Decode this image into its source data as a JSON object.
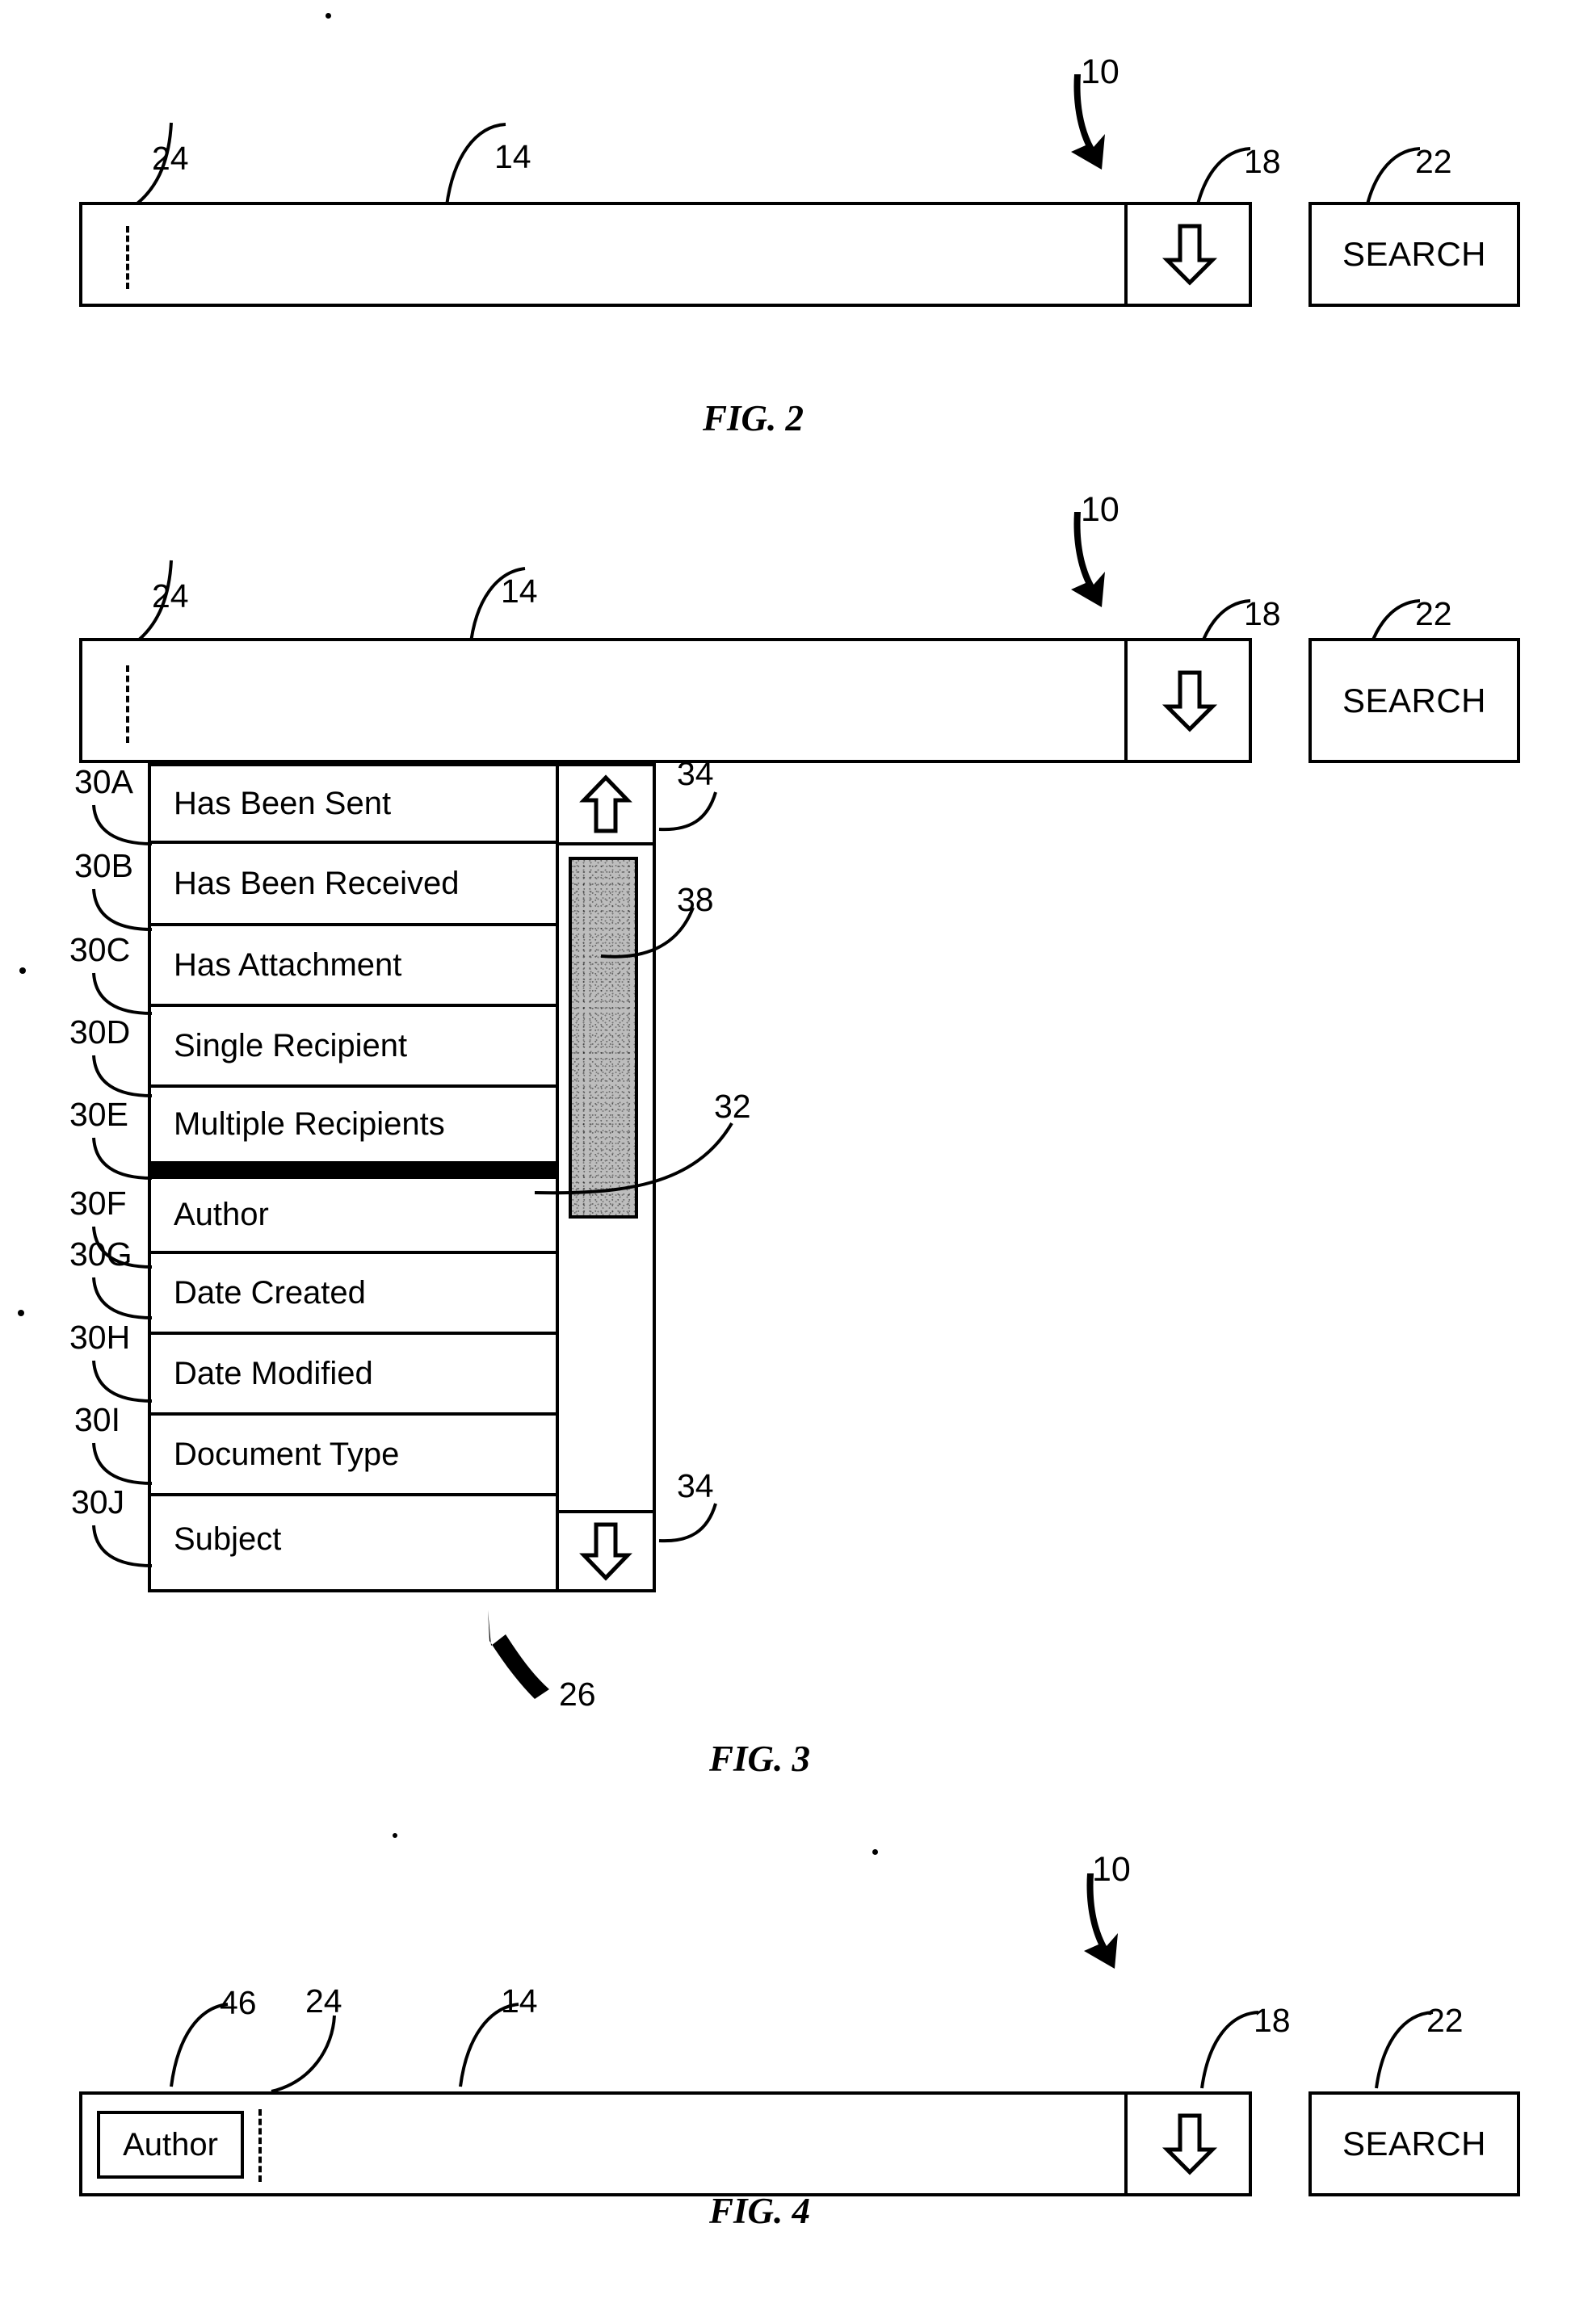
{
  "figures": [
    {
      "id": "fig2",
      "caption": "FIG. 2",
      "refs": {
        "assembly": "10",
        "cursor": "24",
        "input_field": "14",
        "dropdown_button": "18",
        "search_button": "22"
      },
      "search_bar": {
        "input_value": "",
        "dropdown_icon": "down-arrow-icon",
        "search_label": "SEARCH"
      }
    },
    {
      "id": "fig3",
      "caption": "FIG. 3",
      "refs": {
        "assembly": "10",
        "cursor": "24",
        "input_field": "14",
        "dropdown_button": "18",
        "search_button": "22",
        "dropdown_list": "26",
        "scrollbar": "32",
        "scroll_arrow_up": "34",
        "scroll_arrow_down": "34",
        "scroll_thumb": "38"
      },
      "search_bar": {
        "input_value": "",
        "dropdown_icon": "down-arrow-icon",
        "search_label": "SEARCH"
      },
      "dropdown": {
        "scroll_up_icon": "up-arrow-icon",
        "scroll_down_icon": "down-arrow-icon",
        "items": [
          {
            "ref": "30A",
            "label": "Has Been Sent"
          },
          {
            "ref": "30B",
            "label": "Has Been Received"
          },
          {
            "ref": "30C",
            "label": "Has Attachment"
          },
          {
            "ref": "30D",
            "label": "Single Recipient"
          },
          {
            "ref": "30E",
            "label": "Multiple Recipients"
          },
          {
            "ref": "30F",
            "label": "Author"
          },
          {
            "ref": "30G",
            "label": "Date Created"
          },
          {
            "ref": "30H",
            "label": "Date Modified"
          },
          {
            "ref": "30I",
            "label": "Document Type"
          },
          {
            "ref": "30J",
            "label": "Subject"
          }
        ]
      }
    },
    {
      "id": "fig4",
      "caption": "FIG. 4",
      "refs": {
        "assembly": "10",
        "token": "46",
        "cursor": "24",
        "input_field": "14",
        "dropdown_button": "18",
        "search_button": "22"
      },
      "search_bar": {
        "token_label": "Author",
        "input_value": "",
        "dropdown_icon": "down-arrow-icon",
        "search_label": "SEARCH"
      }
    }
  ],
  "colors": {
    "ink": "#000000",
    "paper": "#ffffff",
    "scroll_thumb": "#bdbdbd"
  }
}
